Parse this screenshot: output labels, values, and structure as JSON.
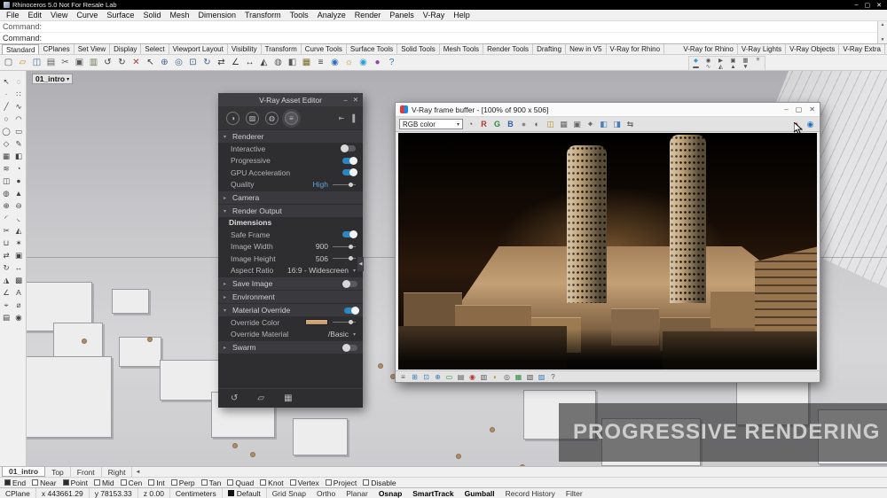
{
  "titlebar": {
    "title": "Rhinoceros 5.0 Not For Resale Lab",
    "minimize": "–",
    "maximize": "▢",
    "close": "✕"
  },
  "menu": {
    "items": [
      "File",
      "Edit",
      "View",
      "Curve",
      "Surface",
      "Solid",
      "Mesh",
      "Dimension",
      "Transform",
      "Tools",
      "Analyze",
      "Render",
      "Panels",
      "V-Ray",
      "Help"
    ]
  },
  "command": {
    "history": "Command:",
    "prompt": "Command:"
  },
  "tabs": {
    "left": [
      "Standard",
      "CPlanes",
      "Set View",
      "Display",
      "Select",
      "Viewport Layout",
      "Visibility",
      "Transform",
      "Curve Tools",
      "Surface Tools",
      "Solid Tools",
      "Mesh Tools",
      "Render Tools",
      "Drafting",
      "New in V5",
      "V-Ray for Rhino"
    ],
    "right": [
      "V-Ray for Rhino",
      "V-Ray Lights",
      "V-Ray Objects",
      "V-Ray Extra"
    ]
  },
  "main_toolbar": {
    "icons": [
      {
        "name": "new-file-icon",
        "glyph": "▢",
        "color": "#5a5a5a"
      },
      {
        "name": "open-file-icon",
        "glyph": "▱",
        "color": "#c08a2a"
      },
      {
        "name": "save-file-icon",
        "glyph": "◫",
        "color": "#4a6d96"
      },
      {
        "name": "print-icon",
        "glyph": "▤",
        "color": "#5a5a5a"
      },
      {
        "name": "cut-icon",
        "glyph": "✂",
        "color": "#5a5a5a"
      },
      {
        "name": "copy-icon",
        "glyph": "▣",
        "color": "#5a5a5a"
      },
      {
        "name": "paste-icon",
        "glyph": "▥",
        "color": "#6a7a55"
      },
      {
        "name": "undo-icon",
        "glyph": "↺",
        "color": "#3a3a3a"
      },
      {
        "name": "redo-icon",
        "glyph": "↻",
        "color": "#3a3a3a"
      },
      {
        "name": "delete-icon",
        "glyph": "✕",
        "color": "#a04040"
      },
      {
        "name": "select-icon",
        "glyph": "↖",
        "color": "#3a3a3a"
      },
      {
        "name": "pan-view-icon",
        "glyph": "⊕",
        "color": "#44618a"
      },
      {
        "name": "zoom-window-icon",
        "glyph": "◎",
        "color": "#44618a"
      },
      {
        "name": "zoom-extents-icon",
        "glyph": "⊡",
        "color": "#44618a"
      },
      {
        "name": "rotate-view-icon",
        "glyph": "↻",
        "color": "#44618a"
      },
      {
        "name": "move-icon",
        "glyph": "⇄",
        "color": "#3a3a3a"
      },
      {
        "name": "rotate-icon",
        "glyph": "∠",
        "color": "#3a3a3a"
      },
      {
        "name": "scale-icon",
        "glyph": "↔",
        "color": "#3a3a3a"
      },
      {
        "name": "mirror-icon",
        "glyph": "◭",
        "color": "#3a3a3a"
      },
      {
        "name": "hide-icon",
        "glyph": "◍",
        "color": "#5a5a5a"
      },
      {
        "name": "lock-icon",
        "glyph": "◧",
        "color": "#5a5a5a"
      },
      {
        "name": "layers-icon",
        "glyph": "▦",
        "color": "#7a6a2a"
      },
      {
        "name": "properties-icon",
        "glyph": "≡",
        "color": "#3a3a3a"
      },
      {
        "name": "earth-icon",
        "glyph": "◉",
        "color": "#2e6fbc"
      },
      {
        "name": "sun-icon",
        "glyph": "☼",
        "color": "#c08a2a"
      },
      {
        "name": "globe-icon",
        "glyph": "◉",
        "color": "#2e9fd0"
      },
      {
        "name": "render-icon",
        "glyph": "●",
        "color": "#8a4a9a"
      },
      {
        "name": "help-icon",
        "glyph": "?",
        "color": "#2e6fbc"
      }
    ]
  },
  "vray_toolbar": {
    "row1": [
      {
        "name": "vray-asset-editor-icon",
        "glyph": "◆",
        "color": "#3aa0c8"
      },
      {
        "name": "vray-render-icon",
        "glyph": "◉",
        "color": "#555555"
      },
      {
        "name": "vray-interactive-icon",
        "glyph": "▶",
        "color": "#555555"
      },
      {
        "name": "vray-viewport-render-icon",
        "glyph": "▣",
        "color": "#555555"
      },
      {
        "name": "vray-frame-buffer-icon",
        "glyph": "▦",
        "color": "#555555"
      },
      {
        "name": "vray-batch-render-icon",
        "glyph": "≡",
        "color": "#555555"
      }
    ],
    "row2": [
      {
        "name": "vray-infinite-plane-icon",
        "glyph": "▬",
        "color": "#555555"
      },
      {
        "name": "vray-fur-icon",
        "glyph": "∿",
        "color": "#555555"
      },
      {
        "name": "vray-clipper-icon",
        "glyph": "◭",
        "color": "#555555"
      },
      {
        "name": "vray-mesh-export-icon",
        "glyph": "▲",
        "color": "#555555"
      },
      {
        "name": "vray-scene-import-icon",
        "glyph": "▼",
        "color": "#555555"
      }
    ]
  },
  "side_toolbar": {
    "icons": [
      {
        "name": "select-tool-icon",
        "glyph": "↖"
      },
      {
        "name": "lasso-tool-icon",
        "glyph": "◌"
      },
      {
        "name": "point-tool-icon",
        "glyph": "∙"
      },
      {
        "name": "points-grid-icon",
        "glyph": "∷"
      },
      {
        "name": "polyline-tool-icon",
        "glyph": "╱"
      },
      {
        "name": "curve-tool-icon",
        "glyph": "∿"
      },
      {
        "name": "circle-tool-icon",
        "glyph": "○"
      },
      {
        "name": "arc-tool-icon",
        "glyph": "◠"
      },
      {
        "name": "ellipse-tool-icon",
        "glyph": "◯"
      },
      {
        "name": "rectangle-tool-icon",
        "glyph": "▭"
      },
      {
        "name": "polygon-tool-icon",
        "glyph": "◇"
      },
      {
        "name": "freeform-tool-icon",
        "glyph": "✎"
      },
      {
        "name": "surface-tool-icon",
        "glyph": "▦"
      },
      {
        "name": "plane-tool-icon",
        "glyph": "◧"
      },
      {
        "name": "loft-tool-icon",
        "glyph": "≋"
      },
      {
        "name": "revolve-tool-icon",
        "glyph": "◔"
      },
      {
        "name": "box-tool-icon",
        "glyph": "◫"
      },
      {
        "name": "sphere-tool-icon",
        "glyph": "●"
      },
      {
        "name": "cylinder-tool-icon",
        "glyph": "◍"
      },
      {
        "name": "cone-tool-icon",
        "glyph": "▲"
      },
      {
        "name": "boolean-union-icon",
        "glyph": "⊕"
      },
      {
        "name": "boolean-difference-icon",
        "glyph": "⊖"
      },
      {
        "name": "fillet-tool-icon",
        "glyph": "◜"
      },
      {
        "name": "chamfer-tool-icon",
        "glyph": "◟"
      },
      {
        "name": "trim-tool-icon",
        "glyph": "✂"
      },
      {
        "name": "split-tool-icon",
        "glyph": "◭"
      },
      {
        "name": "join-tool-icon",
        "glyph": "⊔"
      },
      {
        "name": "explode-tool-icon",
        "glyph": "✶"
      },
      {
        "name": "move-tool-icon",
        "glyph": "⇄"
      },
      {
        "name": "copy-tool-icon",
        "glyph": "▣"
      },
      {
        "name": "rotate-tool-icon",
        "glyph": "↻"
      },
      {
        "name": "scale-tool-icon",
        "glyph": "↔"
      },
      {
        "name": "mirror-tool-icon",
        "glyph": "◮"
      },
      {
        "name": "array-tool-icon",
        "glyph": "▩"
      },
      {
        "name": "dimension-tool-icon",
        "glyph": "∠"
      },
      {
        "name": "text-tool-icon",
        "glyph": "A"
      },
      {
        "name": "measure-tool-icon",
        "glyph": "⌖"
      },
      {
        "name": "analyze-tool-icon",
        "glyph": "⌀"
      },
      {
        "name": "layer-tool-icon",
        "glyph": "▤"
      },
      {
        "name": "render-tool-icon",
        "glyph": "◉"
      }
    ]
  },
  "viewport": {
    "label": "01_intro"
  },
  "asset_editor": {
    "title": "V-Ray Asset Editor",
    "controls": {
      "minimize": "–",
      "close": "✕"
    },
    "tabs": [
      {
        "name": "materials-tab-icon",
        "glyph": "◑"
      },
      {
        "name": "textures-tab-icon",
        "glyph": "▨"
      },
      {
        "name": "geometry-tab-icon",
        "glyph": "◍"
      },
      {
        "name": "settings-tab-icon",
        "glyph": "≡",
        "active": true
      }
    ],
    "right_tabs": [
      {
        "name": "collapse-left-icon",
        "glyph": "⇤"
      },
      {
        "name": "expand-panel-icon",
        "glyph": "▐"
      }
    ],
    "sections": [
      {
        "header": "Renderer",
        "expanded": true,
        "rows": [
          {
            "label": "Interactive",
            "control": "toggle",
            "on": false
          },
          {
            "label": "Progressive",
            "control": "toggle",
            "on": true
          },
          {
            "label": "GPU Acceleration",
            "control": "toggle",
            "on": true
          },
          {
            "label": "Quality",
            "control": "slider",
            "value": "High"
          }
        ]
      },
      {
        "header": "Camera",
        "expanded": false,
        "rows": []
      },
      {
        "header": "Render Output",
        "expanded": true,
        "rows": [
          {
            "label": "Dimensions",
            "control": "subheader"
          },
          {
            "label": "Safe Frame",
            "control": "toggle",
            "on": true
          },
          {
            "label": "Image Width",
            "control": "numslider",
            "value": "900"
          },
          {
            "label": "Image Height",
            "control": "numslider",
            "value": "506"
          },
          {
            "label": "Aspect Ratio",
            "control": "dropdown",
            "value": "16:9 - Widescreen"
          }
        ]
      },
      {
        "header": "Save Image",
        "expanded": false,
        "toggle": false,
        "rows": []
      },
      {
        "header": "Environment",
        "expanded": false,
        "rows": []
      },
      {
        "header": "Material Override",
        "expanded": true,
        "toggle": true,
        "rows": [
          {
            "label": "Override Color",
            "control": "color",
            "value": "#c2996c"
          },
          {
            "label": "Override Material",
            "control": "dropdown",
            "value": "/Basic"
          }
        ]
      },
      {
        "header": "Swarm",
        "expanded": false,
        "toggle": false,
        "rows": []
      }
    ],
    "footer": [
      {
        "name": "undo-icon",
        "glyph": "↺"
      },
      {
        "name": "open-scene-icon",
        "glyph": "▱"
      },
      {
        "name": "render-button",
        "glyph": "▦"
      }
    ]
  },
  "frame_buffer": {
    "title": "V-Ray frame buffer - [100% of 900 x 506]",
    "controls": {
      "minimize": "–",
      "maximize": "▢",
      "close": "✕"
    },
    "channel_dropdown": "RGB color",
    "toolbar_icons": [
      {
        "name": "color-corrections-icon",
        "glyph": "◔",
        "color": "#555555"
      },
      {
        "name": "red-channel-icon",
        "glyph": "R",
        "color": "#b03a30"
      },
      {
        "name": "green-channel-icon",
        "glyph": "G",
        "color": "#2f8a3c"
      },
      {
        "name": "blue-channel-icon",
        "glyph": "B",
        "color": "#2f62b0"
      },
      {
        "name": "alpha-channel-icon",
        "glyph": "●",
        "color": "#8a8a8a"
      },
      {
        "name": "monochrome-icon",
        "glyph": "◐",
        "color": "#555555"
      },
      {
        "name": "save-image-icon",
        "glyph": "◫",
        "color": "#b8912a"
      },
      {
        "name": "clear-image-icon",
        "glyph": "▦",
        "color": "#666666"
      },
      {
        "name": "duplicate-buffer-icon",
        "glyph": "▣",
        "color": "#666666"
      },
      {
        "name": "track-mouse-icon",
        "glyph": "⌖",
        "color": "#666666"
      },
      {
        "name": "pin-a-icon",
        "glyph": "◧",
        "color": "#4a7fb5"
      },
      {
        "name": "pin-b-icon",
        "glyph": "◨",
        "color": "#4a7fb5"
      },
      {
        "name": "compare-icon",
        "glyph": "⇆",
        "color": "#666666"
      }
    ],
    "right_icons": [
      {
        "name": "stop-render-button",
        "glyph": "●",
        "color": "#cc2b25"
      },
      {
        "name": "render-last-button",
        "glyph": "◉",
        "color": "#1d6fc2"
      }
    ],
    "bottom_icons": [
      {
        "name": "fb-info-icon",
        "glyph": "≡",
        "color": "#555555"
      },
      {
        "name": "fb-zoom-fit-icon",
        "glyph": "⊞",
        "color": "#3a7fb5"
      },
      {
        "name": "fb-zoom-100-icon",
        "glyph": "⊡",
        "color": "#3a7fb5"
      },
      {
        "name": "fb-pan-icon",
        "glyph": "⊕",
        "color": "#3a7fb5"
      },
      {
        "name": "fb-region-render-icon",
        "glyph": "▭",
        "color": "#2f8a3c"
      },
      {
        "name": "fb-stamp-icon",
        "glyph": "▤",
        "color": "#555555"
      },
      {
        "name": "fb-color-sample-icon",
        "glyph": "◉",
        "color": "#b03a30"
      },
      {
        "name": "fb-histogram-icon",
        "glyph": "▥",
        "color": "#555555"
      },
      {
        "name": "fb-exposure-icon",
        "glyph": "◐",
        "color": "#b8912a"
      },
      {
        "name": "fb-white-balance-icon",
        "glyph": "◎",
        "color": "#555555"
      },
      {
        "name": "fb-lut-icon",
        "glyph": "▦",
        "color": "#2f8a3c"
      },
      {
        "name": "fb-srgb-icon",
        "glyph": "▧",
        "color": "#555555"
      },
      {
        "name": "fb-aa-icon",
        "glyph": "▨",
        "color": "#3a7fb5"
      },
      {
        "name": "fb-help-icon",
        "glyph": "?",
        "color": "#555555"
      }
    ]
  },
  "overlay": {
    "text": "PROGRESSIVE RENDERING"
  },
  "viewport_tabs": {
    "nav_glyph": "◄",
    "items": [
      {
        "label": "01_intro",
        "active": true
      },
      {
        "label": "Top",
        "active": false
      },
      {
        "label": "Front",
        "active": false
      },
      {
        "label": "Right",
        "active": false
      }
    ]
  },
  "osnap": {
    "items": [
      {
        "label": "End",
        "checked": true
      },
      {
        "label": "Near",
        "checked": false
      },
      {
        "label": "Point",
        "checked": true
      },
      {
        "label": "Mid",
        "checked": false
      },
      {
        "label": "Cen",
        "checked": false
      },
      {
        "label": "Int",
        "checked": false
      },
      {
        "label": "Perp",
        "checked": false
      },
      {
        "label": "Tan",
        "checked": false
      },
      {
        "label": "Quad",
        "checked": false
      },
      {
        "label": "Knot",
        "checked": false
      },
      {
        "label": "Vertex",
        "checked": false
      },
      {
        "label": "Project",
        "checked": false
      },
      {
        "label": "Disable",
        "checked": false
      }
    ]
  },
  "status": {
    "cplane": "CPlane",
    "x": "x 443661.29",
    "y": "y 78153.33",
    "z": "z 0.00",
    "units": "Centimeters",
    "layer": "Default",
    "toggles": [
      {
        "label": "Grid Snap",
        "active": false
      },
      {
        "label": "Ortho",
        "active": false
      },
      {
        "label": "Planar",
        "active": false
      },
      {
        "label": "Osnap",
        "active": true
      },
      {
        "label": "SmartTrack",
        "active": true
      },
      {
        "label": "Gumball",
        "active": true
      },
      {
        "label": "Record History",
        "active": false
      },
      {
        "label": "Filter",
        "active": false
      }
    ]
  }
}
